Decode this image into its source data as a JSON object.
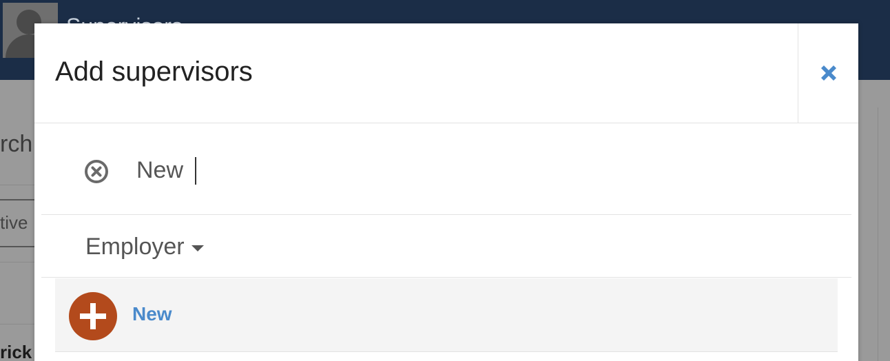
{
  "background": {
    "app_title": "Supervisors",
    "search_fragment": "rch",
    "status_fragment": "tive",
    "name_fragment": "rick"
  },
  "modal": {
    "title": "Add supervisors",
    "close_icon": "close-icon",
    "search": {
      "value": "New",
      "clear_icon": "clear-circle-icon"
    },
    "filter": {
      "label": "Employer",
      "icon": "caret-down-icon"
    },
    "results": [
      {
        "label": "New",
        "icon": "add-circle-icon"
      }
    ]
  },
  "colors": {
    "header_bg": "#1b2d47",
    "close_icon": "#4a8acb",
    "add_icon_bg": "#b34a1c",
    "link": "#4a8acb"
  }
}
